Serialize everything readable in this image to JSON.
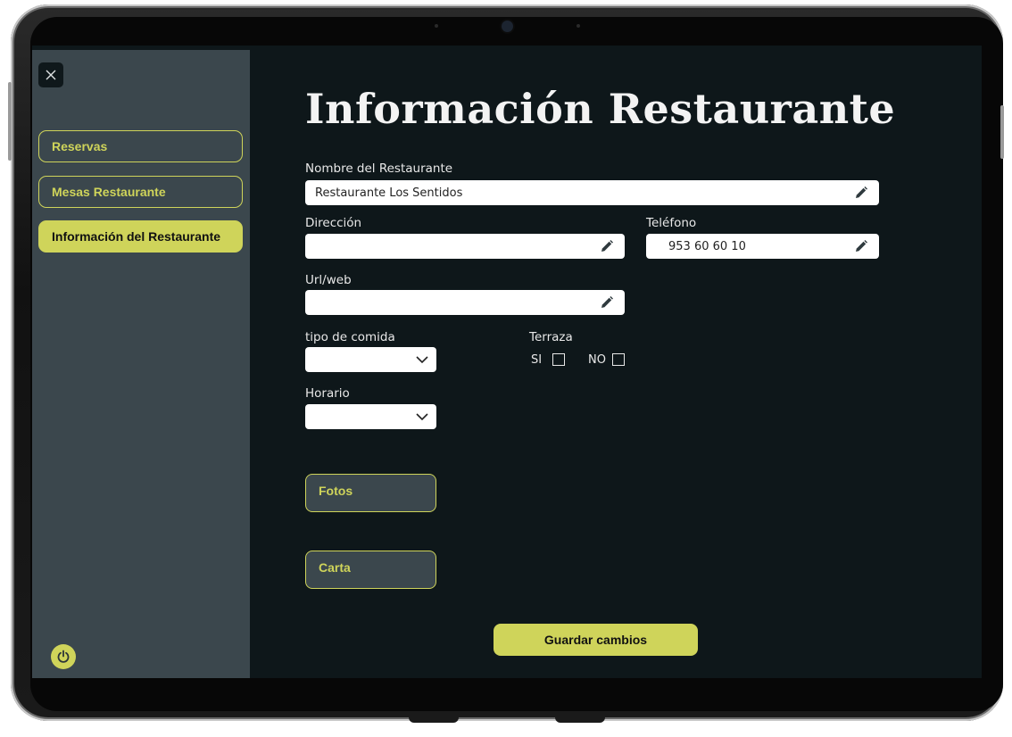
{
  "sidebar": {
    "items": [
      {
        "label": "Reservas",
        "active": false
      },
      {
        "label": "Mesas Restaurante",
        "active": false
      },
      {
        "label": "Información del Restaurante",
        "active": true
      }
    ]
  },
  "page": {
    "title": "Información Restaurante"
  },
  "form": {
    "nombre": {
      "label": "Nombre del Restaurante",
      "value": "Restaurante Los Sentidos"
    },
    "direccion": {
      "label": "Dirección",
      "value": ""
    },
    "telefono": {
      "label": "Teléfono",
      "value": "953 60 60 10"
    },
    "url": {
      "label": "Url/web",
      "value": ""
    },
    "tipo_comida": {
      "label": "tipo de comida",
      "selected": ""
    },
    "terraza": {
      "label": "Terraza",
      "si_label": "SI",
      "no_label": "NO",
      "si_checked": false,
      "no_checked": false
    },
    "horario": {
      "label": "Horario",
      "selected": ""
    }
  },
  "buttons": {
    "fotos": "Fotos",
    "carta": "Carta",
    "save": "Guardar cambios"
  },
  "colors": {
    "accent": "#cfd45a",
    "sidebar_bg": "#3b474d",
    "screen_bg": "#0e171a"
  },
  "icons": {
    "close": "close-icon",
    "edit": "pencil-icon",
    "dropdown": "chevron-down-icon",
    "power": "power-icon"
  }
}
